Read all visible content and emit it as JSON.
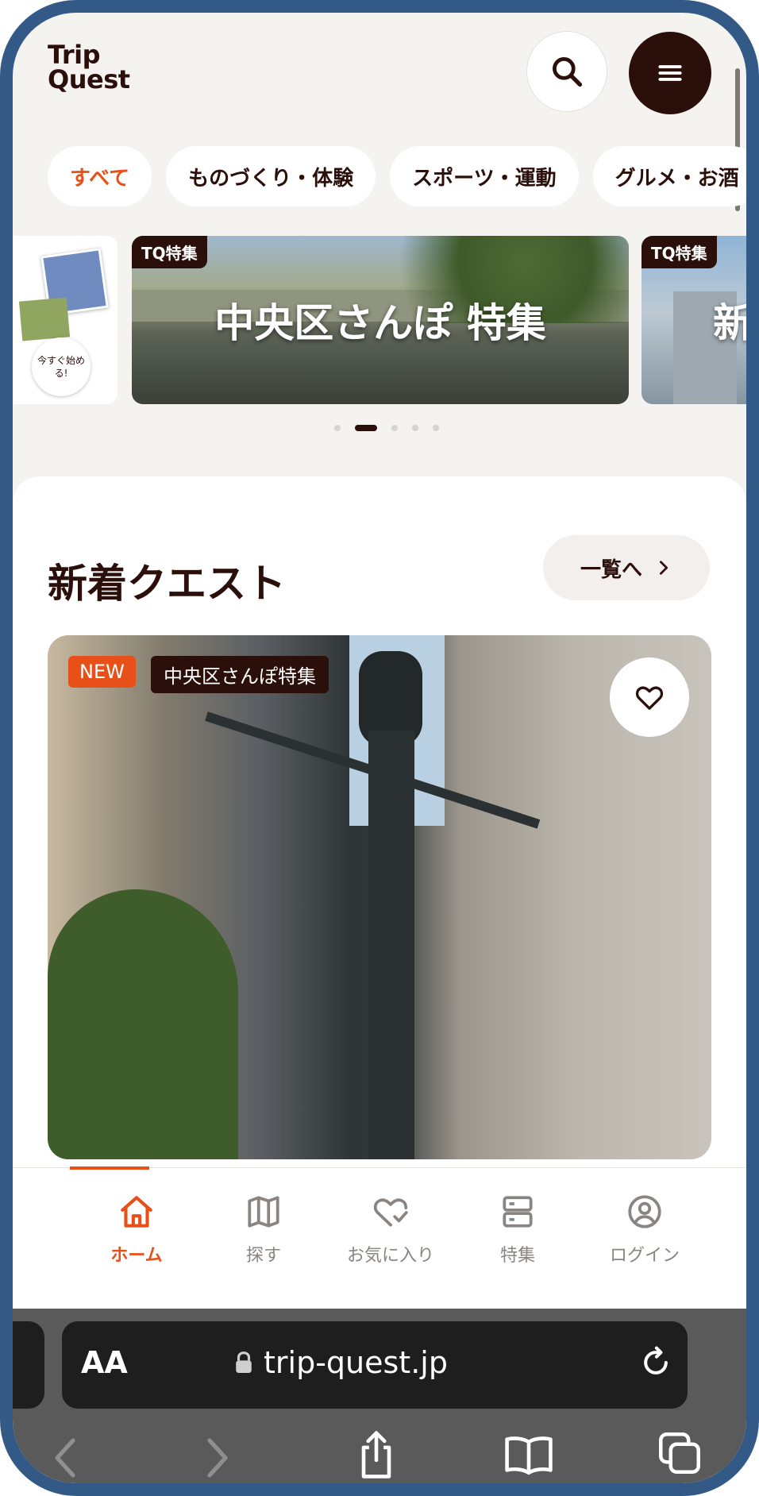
{
  "header": {
    "logo_line1": "Trip",
    "logo_line2": "Quest",
    "search_icon": "search-icon",
    "menu_icon": "hamburger-menu-icon"
  },
  "categories": [
    {
      "label": "すべて",
      "active": true
    },
    {
      "label": "ものづくり・体験",
      "active": false
    },
    {
      "label": "スポーツ・運動",
      "active": false
    },
    {
      "label": "グルメ・お酒",
      "active": false
    }
  ],
  "banners": {
    "left_badge_text": "今すぐ始める!",
    "main_tag": "TQ特集",
    "main_title": "中央区さんぽ 特集",
    "right_tag": "TQ特集",
    "right_title_partial": "新",
    "pagination_total": 5,
    "pagination_active_index": 1
  },
  "new_quests": {
    "title": "新着クエスト",
    "more_label": "一覧へ",
    "card": {
      "badge_new": "NEW",
      "badge_feature": "中央区さんぽ特集",
      "favorite_icon": "heart-icon"
    }
  },
  "tabbar": {
    "items": [
      {
        "label": "ホーム",
        "icon": "home-icon",
        "active": true
      },
      {
        "label": "探す",
        "icon": "map-icon",
        "active": false
      },
      {
        "label": "お気に入り",
        "icon": "heart-check-icon",
        "active": false
      },
      {
        "label": "特集",
        "icon": "feature-list-icon",
        "active": false
      },
      {
        "label": "ログイン",
        "icon": "user-circle-icon",
        "active": false
      }
    ]
  },
  "browser": {
    "aa_label": "AA",
    "url": "trip-quest.jp"
  },
  "colors": {
    "accent": "#e8501a",
    "dark": "#2a0f0a",
    "frame": "#335a87",
    "background": "#f4f3f0"
  }
}
